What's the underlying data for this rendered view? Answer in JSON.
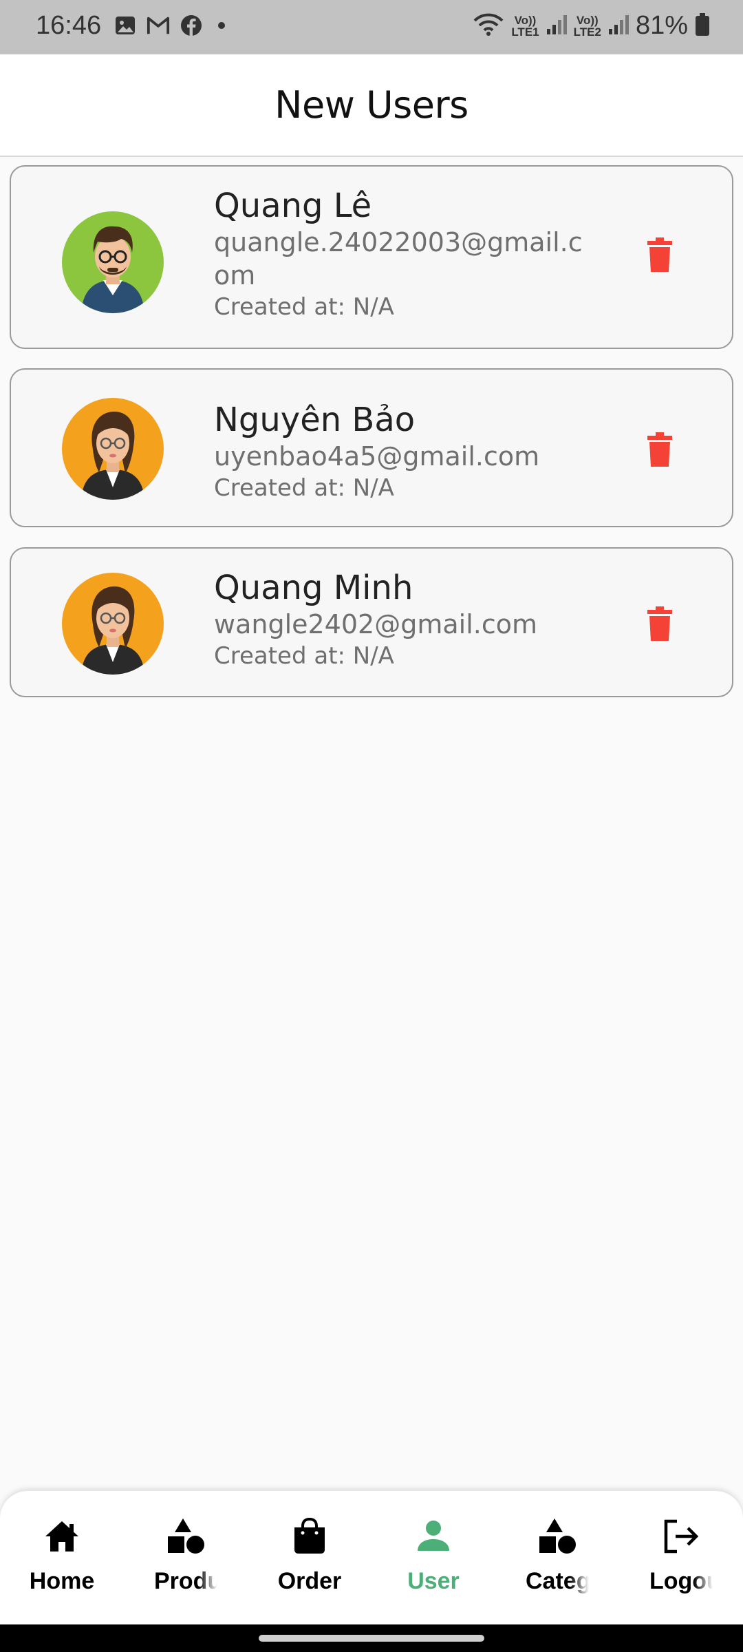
{
  "status_bar": {
    "time": "16:46",
    "left_icons": [
      "gallery-icon",
      "gmail-icon",
      "facebook-icon"
    ],
    "net1": [
      "Vo))",
      "LTE1"
    ],
    "net2": [
      "Vo))",
      "LTE2"
    ],
    "battery": "81%"
  },
  "header": {
    "title": "New Users"
  },
  "users": [
    {
      "name": "Quang Lê",
      "email": "quangle.24022003@gmail.com",
      "created": "Created at: N/A",
      "avatar": "male-avatar",
      "avatar_bg": "#8cc63f"
    },
    {
      "name": "Nguyên Bảo",
      "email": "uyenbao4a5@gmail.com",
      "created": "Created at: N/A",
      "avatar": "female-avatar",
      "avatar_bg": "#f4a21d"
    },
    {
      "name": "Quang Minh",
      "email": "wangle2402@gmail.com",
      "created": "Created at: N/A",
      "avatar": "female-avatar",
      "avatar_bg": "#f4a21d"
    }
  ],
  "colors": {
    "delete": "#f44336",
    "active_tab": "#4caf78"
  },
  "nav": {
    "items": [
      {
        "label": "Home",
        "icon": "home-icon"
      },
      {
        "label": "Produ",
        "icon": "shapes-icon"
      },
      {
        "label": "Order",
        "icon": "bag-icon"
      },
      {
        "label": "User",
        "icon": "user-icon"
      },
      {
        "label": "Categ",
        "icon": "shapes-icon"
      },
      {
        "label": "Logou",
        "icon": "logout-icon"
      }
    ],
    "active": "User"
  }
}
